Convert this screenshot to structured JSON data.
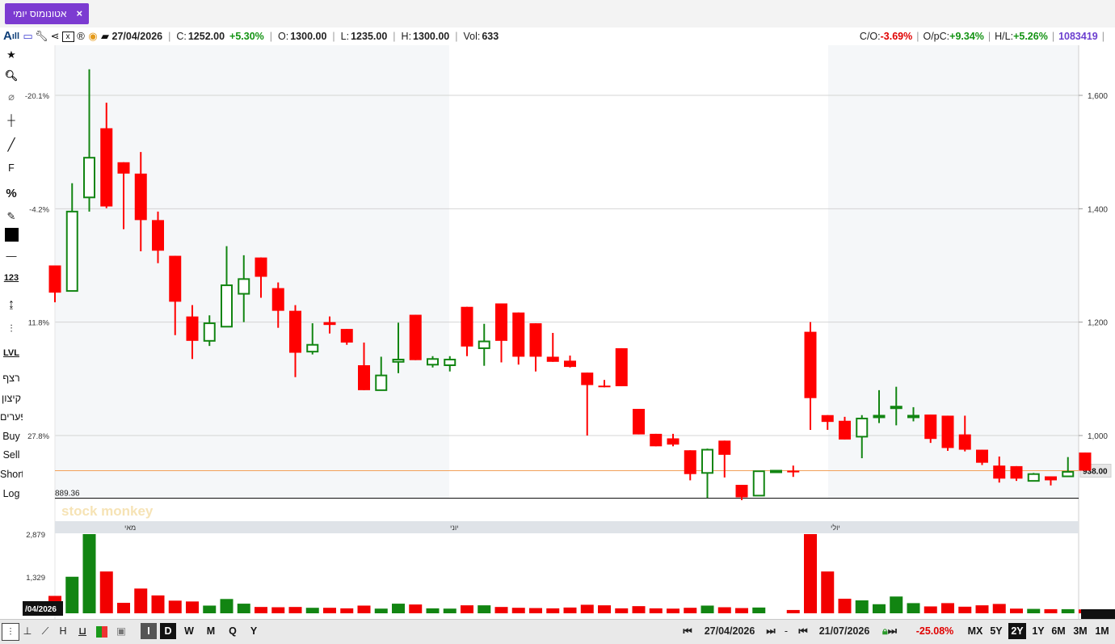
{
  "tab": {
    "label": "אטונומוס יומי",
    "close": "×"
  },
  "info": {
    "date": "27/04/2026",
    "c_label": "C:",
    "c_value": "1252.00",
    "c_change": "+5.30%",
    "o_label": "O:",
    "o_value": "1300.00",
    "l_label": "L:",
    "l_value": "1235.00",
    "h_label": "H:",
    "h_value": "1300.00",
    "vol_label": "Vol:",
    "vol_value": "633",
    "co_label": "C/O:",
    "co_value": "-3.69%",
    "opc_label": "O/pC:",
    "opc_value": "+9.34%",
    "hl_label": "H/L:",
    "hl_value": "+5.26%",
    "id_value": "1083419"
  },
  "toolbar": {
    "f_label": "F",
    "pct_label": "%",
    "num_label": "123",
    "lvl_label": "LVL",
    "rezef": "רצף",
    "kitzun": "קיצון",
    "pearim": "פערים",
    "buy": "Buy",
    "sell": "Sell",
    "short": "Short",
    "log": "Log"
  },
  "bottom": {
    "h": "H",
    "i": "I",
    "d": "D",
    "w": "W",
    "m": "M",
    "q": "Q",
    "y": "Y",
    "start_date": "27/04/2026",
    "end_date": "21/07/2026",
    "dash": "-",
    "change": "-25.08%",
    "mx": "MX",
    "p5y": "5Y",
    "p2y": "2Y",
    "p1y": "1Y",
    "p6m": "6M",
    "p3m": "3M",
    "p1m": "1M"
  },
  "chart_data": {
    "type": "candlestick",
    "price_axis": {
      "ticks": [
        1000,
        1200,
        1400,
        1600
      ],
      "tick_labels": [
        "1,000",
        "1,200",
        "1,400",
        "1,600"
      ]
    },
    "pct_axis": {
      "tick_labels": [
        "27.8%",
        "11.8%",
        "-4.2%",
        "-20.1%"
      ]
    },
    "current_price_label": "938.00",
    "current_price": 938,
    "low_line_label": "889.36",
    "low_line": 889.36,
    "month_labels": [
      "מאי",
      "יוני",
      "יולי"
    ],
    "watermark": "stock monkey",
    "volume_axis": {
      "tick_labels": [
        "2,879",
        "1,329"
      ],
      "ticks": [
        2879,
        1329
      ]
    },
    "volume_corner_label": "/04/2026",
    "colors": {
      "up": "#128512",
      "down": "#ff0000",
      "grid": "#d4d4d4",
      "price_line": "#f2a15a"
    },
    "candles": [
      {
        "o": 1300,
        "h": 1300,
        "l": 1235,
        "c": 1252,
        "v": 633
      },
      {
        "o": 1255,
        "h": 1445,
        "l": 1255,
        "c": 1395,
        "v": 1329
      },
      {
        "o": 1420,
        "h": 1646,
        "l": 1395,
        "c": 1490,
        "v": 2879
      },
      {
        "o": 1542,
        "h": 1587,
        "l": 1401,
        "c": 1404,
        "v": 1520
      },
      {
        "o": 1482,
        "h": 1482,
        "l": 1364,
        "c": 1462,
        "v": 380
      },
      {
        "o": 1462,
        "h": 1500,
        "l": 1325,
        "c": 1380,
        "v": 900
      },
      {
        "o": 1380,
        "h": 1395,
        "l": 1304,
        "c": 1326,
        "v": 650
      },
      {
        "o": 1317,
        "h": 1317,
        "l": 1177,
        "c": 1236,
        "v": 460
      },
      {
        "o": 1210,
        "h": 1230,
        "l": 1135,
        "c": 1167,
        "v": 430
      },
      {
        "o": 1167,
        "h": 1212,
        "l": 1158,
        "c": 1198,
        "v": 280
      },
      {
        "o": 1192,
        "h": 1334,
        "l": 1192,
        "c": 1265,
        "v": 520
      },
      {
        "o": 1250,
        "h": 1318,
        "l": 1200,
        "c": 1276,
        "v": 350
      },
      {
        "o": 1314,
        "h": 1314,
        "l": 1243,
        "c": 1280,
        "v": 230
      },
      {
        "o": 1260,
        "h": 1270,
        "l": 1190,
        "c": 1220,
        "v": 220
      },
      {
        "o": 1220,
        "h": 1230,
        "l": 1103,
        "c": 1146,
        "v": 230
      },
      {
        "o": 1148,
        "h": 1198,
        "l": 1143,
        "c": 1160,
        "v": 200
      },
      {
        "o": 1200,
        "h": 1210,
        "l": 1180,
        "c": 1195,
        "v": 200
      },
      {
        "o": 1188,
        "h": 1188,
        "l": 1160,
        "c": 1164,
        "v": 180
      },
      {
        "o": 1124,
        "h": 1164,
        "l": 1088,
        "c": 1080,
        "v": 280
      },
      {
        "o": 1080,
        "h": 1139,
        "l": 1080,
        "c": 1106,
        "v": 170
      },
      {
        "o": 1130,
        "h": 1199,
        "l": 1110,
        "c": 1134,
        "v": 350
      },
      {
        "o": 1213,
        "h": 1213,
        "l": 1133,
        "c": 1133,
        "v": 320
      },
      {
        "o": 1125,
        "h": 1140,
        "l": 1120,
        "c": 1135,
        "v": 180
      },
      {
        "o": 1124,
        "h": 1140,
        "l": 1113,
        "c": 1134,
        "v": 170
      },
      {
        "o": 1227,
        "h": 1227,
        "l": 1140,
        "c": 1157,
        "v": 290
      },
      {
        "o": 1154,
        "h": 1197,
        "l": 1123,
        "c": 1166,
        "v": 290
      },
      {
        "o": 1233,
        "h": 1233,
        "l": 1129,
        "c": 1167,
        "v": 230
      },
      {
        "o": 1217,
        "h": 1217,
        "l": 1125,
        "c": 1139,
        "v": 200
      },
      {
        "o": 1198,
        "h": 1198,
        "l": 1113,
        "c": 1139,
        "v": 190
      },
      {
        "o": 1139,
        "h": 1181,
        "l": 1130,
        "c": 1130,
        "v": 180
      },
      {
        "o": 1132,
        "h": 1141,
        "l": 1120,
        "c": 1121,
        "v": 210
      },
      {
        "o": 1111,
        "h": 1111,
        "l": 1000,
        "c": 1089,
        "v": 310
      },
      {
        "o": 1088,
        "h": 1098,
        "l": 1085,
        "c": 1087,
        "v": 290
      },
      {
        "o": 1154,
        "h": 1154,
        "l": 1087,
        "c": 1087,
        "v": 180
      },
      {
        "o": 1047,
        "h": 1047,
        "l": 1002,
        "c": 1002,
        "v": 260
      },
      {
        "o": 1003,
        "h": 1003,
        "l": 981,
        "c": 981,
        "v": 180
      },
      {
        "o": 995,
        "h": 1003,
        "l": 981,
        "c": 984,
        "v": 170
      },
      {
        "o": 974,
        "h": 974,
        "l": 921,
        "c": 932,
        "v": 200
      },
      {
        "o": 934,
        "h": 977,
        "l": 890,
        "c": 975,
        "v": 280
      },
      {
        "o": 991,
        "h": 991,
        "l": 926,
        "c": 966,
        "v": 220
      },
      {
        "o": 913,
        "h": 913,
        "l": 886,
        "c": 891,
        "v": 190
      },
      {
        "o": 894,
        "h": 937,
        "l": 894,
        "c": 937,
        "v": 210
      },
      {
        "o": 938,
        "h": 939,
        "l": 937,
        "c": 938,
        "v": 0
      },
      {
        "o": 938,
        "h": 947,
        "l": 927,
        "c": 935,
        "v": 120
      },
      {
        "o": 1183,
        "h": 1200,
        "l": 1010,
        "c": 1066,
        "v": 2879
      },
      {
        "o": 1036,
        "h": 1011,
        "l": 1010,
        "c": 1024,
        "v": 1520
      },
      {
        "o": 1026,
        "h": 1033,
        "l": 994,
        "c": 993,
        "v": 530
      },
      {
        "o": 998,
        "h": 1036,
        "l": 960,
        "c": 1030,
        "v": 470
      },
      {
        "o": 1035,
        "h": 1080,
        "l": 1022,
        "c": 1035,
        "v": 330
      },
      {
        "o": 1051,
        "h": 1086,
        "l": 1018,
        "c": 1051,
        "v": 610
      },
      {
        "o": 1035,
        "h": 1050,
        "l": 1025,
        "c": 1035,
        "v": 370
      },
      {
        "o": 1037,
        "h": 1037,
        "l": 987,
        "c": 994,
        "v": 250
      },
      {
        "o": 1035,
        "h": 1035,
        "l": 973,
        "c": 978,
        "v": 370
      },
      {
        "o": 1002,
        "h": 1035,
        "l": 972,
        "c": 975,
        "v": 240
      },
      {
        "o": 975,
        "h": 975,
        "l": 948,
        "c": 952,
        "v": 290
      },
      {
        "o": 947,
        "h": 963,
        "l": 917,
        "c": 924,
        "v": 340
      },
      {
        "o": 946,
        "h": 946,
        "l": 920,
        "c": 924,
        "v": 170
      },
      {
        "o": 920,
        "h": 934,
        "l": 920,
        "c": 932,
        "v": 160
      },
      {
        "o": 928,
        "h": 928,
        "l": 912,
        "c": 921,
        "v": 150
      },
      {
        "o": 928,
        "h": 962,
        "l": 928,
        "c": 936,
        "v": 150
      },
      {
        "o": 970,
        "h": 970,
        "l": 938,
        "c": 938,
        "v": 140
      }
    ]
  }
}
